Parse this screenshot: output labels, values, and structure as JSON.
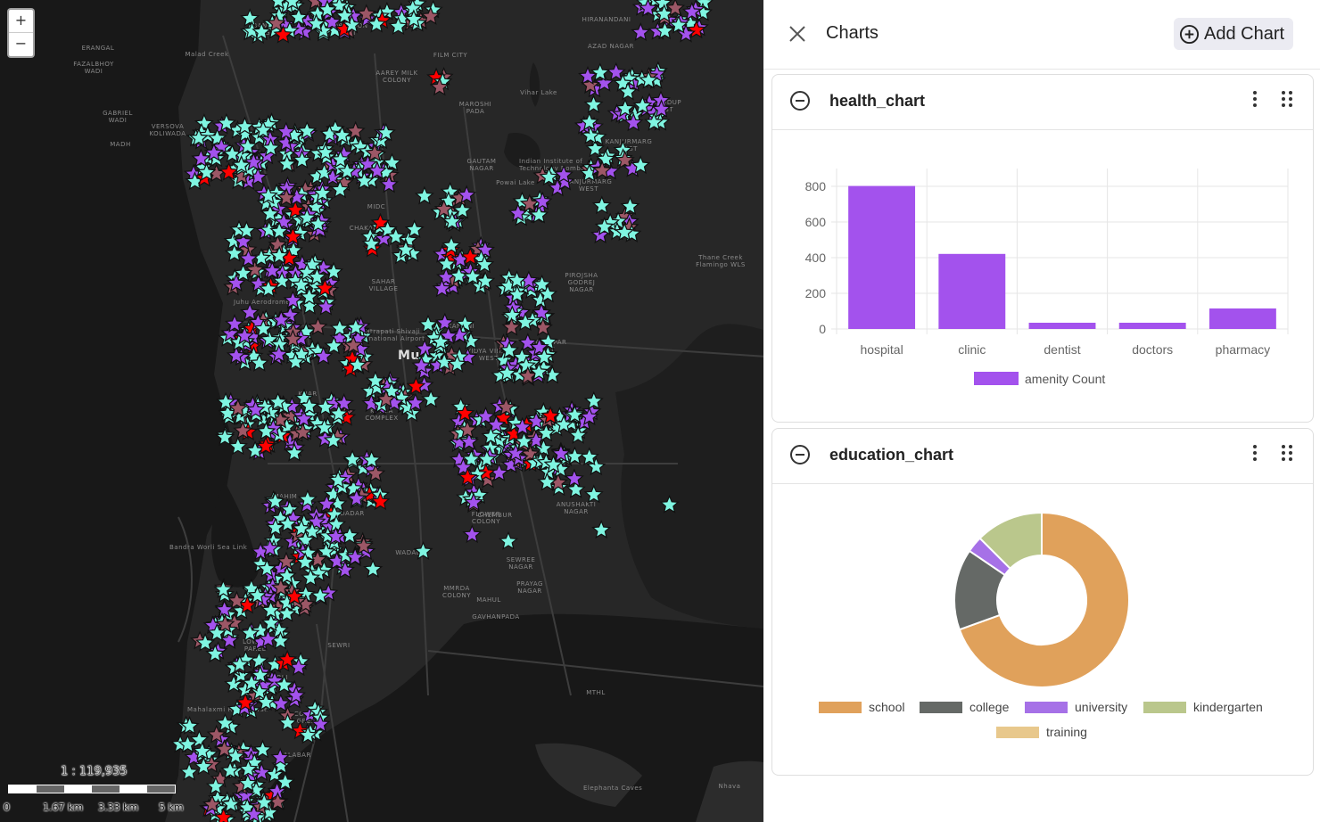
{
  "map": {
    "zoom_in_label": "+",
    "zoom_out_label": "−",
    "scale_ratio": "1 : 119,935",
    "scale_ticks": [
      "0",
      "1.67 km",
      "3.33 km",
      "5 km"
    ],
    "place_labels": [
      "BANGUR\nNAGAR",
      "GOREGAON\nEAST",
      "ERANGAL",
      "FAZALBHOY\nWADI",
      "Malad Creek",
      "AAREY MILK\nCOLONY",
      "FILM CITY",
      "HIRANANDANI",
      "AZAD NAGAR",
      "GABRIEL\nWADI",
      "VERSOVA\nKOLIWADA",
      "MADH",
      "MAROSHI\nPADA",
      "Vihar Lake",
      "BHANDUP\nEAST",
      "KANJURMARG\nEAST",
      "GAUTAM\nNAGAR",
      "Indian Institute of\nTechnology Bombay",
      "Powai Lake",
      "KANJURMARG\nWEST",
      "MIDC",
      "CHAKALA",
      "SAHAR\nVILLAGE",
      "Thane Creek\nFlamingo WLS",
      "PIROJSHA\nGODREJ\nNAGAR",
      "Juhu Aerodrome",
      "Chhatrapati Shivaji\nInternational Airport",
      "KAMANI",
      "VIDYA VIHAR\nWEST",
      "GHATKOPAR\nEAST",
      "Mu",
      "BANDRA\nKURLA\nCOMPLEX",
      "KHAR",
      "MAHIM",
      "DADAR",
      "CHEMBUR",
      "ANUSHAKTI\nNAGAR",
      "FLOWER\nCOLONY",
      "WADALA",
      "SEWREE\nNAGAR",
      "PRAYAG\nNAGAR",
      "MMRDA\nCOLONY",
      "MAHUL",
      "GAVHANPADA",
      "LOWER\nPAREL",
      "WORLI",
      "SEWRI",
      "MTHL",
      "Mahalaxmi Racecourse",
      "COTTON\nGREEN",
      "MALABAR",
      "Elephanta Caves",
      "Nhava",
      "Bandra Worli Sea Link"
    ],
    "marker_colors": {
      "teal": "#7ff5e1",
      "purple": "#a352ed",
      "mauve": "#9c5766",
      "red": "#ff0000"
    }
  },
  "panel": {
    "title": "Charts",
    "add_chart_label": "Add Chart",
    "cards": [
      {
        "title": "health_chart"
      },
      {
        "title": "education_chart"
      }
    ]
  },
  "chart_data": [
    {
      "type": "bar",
      "title": "health_chart",
      "categories": [
        "hospital",
        "clinic",
        "dentist",
        "doctors",
        "pharmacy"
      ],
      "series": [
        {
          "name": "amenity Count",
          "values": [
            802,
            421,
            35,
            35,
            115
          ],
          "color": "#a352ed"
        }
      ],
      "ylim": [
        0,
        900
      ],
      "yticks": [
        "0",
        "200",
        "400",
        "600",
        "800"
      ],
      "grid": true,
      "legend": "bottom"
    },
    {
      "type": "pie",
      "subtype": "donut",
      "title": "education_chart",
      "labels": [
        "school",
        "college",
        "university",
        "kindergarten",
        "training"
      ],
      "values": [
        69.5,
        15,
        3,
        12.5,
        0
      ],
      "colors": [
        "#e0a15b",
        "#656966",
        "#a671e7",
        "#bac78c",
        "#e8c88c"
      ],
      "legend": "bottom"
    }
  ]
}
